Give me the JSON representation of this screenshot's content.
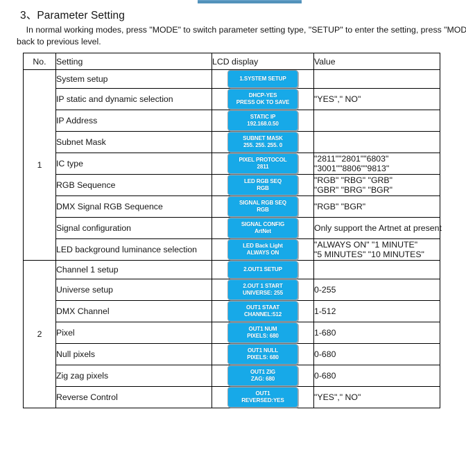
{
  "document": {
    "section_heading": "3、Parameter Setting",
    "intro_paragraph": "    In normal working modes, press \"MODE\" to switch parameter setting type, \"SETUP\" to enter the setting, press \"MODE\" to back to previous level."
  },
  "table": {
    "headers": {
      "no": "No.",
      "setting": "Setting",
      "lcd": "LCD display",
      "value": "Value"
    },
    "groups": [
      {
        "number": "1",
        "rows": [
          {
            "setting": "System setup",
            "lcd_line1": "1.SYSTEM SETUP",
            "lcd_line2": "",
            "value_line1": "",
            "value_line2": ""
          },
          {
            "setting": "IP static and dynamic selection",
            "lcd_line1": "DHCP-YES",
            "lcd_line2": "PRESS OK TO SAVE",
            "value_line1": "\"YES\",\" NO\"",
            "value_line2": ""
          },
          {
            "setting": "IP Address",
            "lcd_line1": "STATIC IP",
            "lcd_line2": "192.168.0.50",
            "value_line1": "",
            "value_line2": ""
          },
          {
            "setting": "Subnet Mask",
            "lcd_line1": "SUBNET MASK",
            "lcd_line2": "255. 255. 255. 0",
            "value_line1": "",
            "value_line2": ""
          },
          {
            "setting": "IC type",
            "lcd_line1": "PIXEL PROTOCOL",
            "lcd_line2": "2811",
            "value_line1": "\"2811\"\"2801\"\"6803\"",
            "value_line2": "\"3001\"\"8806\"\"9813\""
          },
          {
            "setting": "RGB Sequence",
            "lcd_line1": "LED RGB SEQ",
            "lcd_line2": "RGB",
            "value_line1": "\"RGB\" \"RBG\" \"GRB\"",
            "value_line2": "\"GBR\" \"BRG\" \"BGR\""
          },
          {
            "setting": "DMX Signal RGB Sequence",
            "lcd_line1": "SIGNAL RGB SEQ",
            "lcd_line2": "RGB",
            "value_line1": "\"RGB\" \"BGR\"",
            "value_line2": ""
          },
          {
            "setting": "Signal configuration",
            "lcd_line1": "SIGNAL CONFIG",
            "lcd_line2": "ArtNet",
            "value_line1": "Only support the Artnet at present",
            "value_line2": ""
          },
          {
            "setting": "LED background luminance selection",
            "lcd_line1": "LED Back Light",
            "lcd_line2": "ALWAYS ON",
            "value_line1": "\"ALWAYS ON\" \"1 MINUTE\"",
            "value_line2": "\"5 MINUTES\" \"10 MINUTES\""
          }
        ]
      },
      {
        "number": "2",
        "rows": [
          {
            "setting": "Channel 1 setup",
            "lcd_line1": "2.OUT1 SETUP",
            "lcd_line2": "",
            "value_line1": "",
            "value_line2": ""
          },
          {
            "setting": "Universe setup",
            "lcd_line1": "2.OUT 1 START",
            "lcd_line2": "UNIVERSE: 255",
            "value_line1": "0-255",
            "value_line2": ""
          },
          {
            "setting": "DMX Channel",
            "lcd_line1": "OUT1 STAAT",
            "lcd_line2": "CHANNEL:512",
            "value_line1": "1-512",
            "value_line2": ""
          },
          {
            "setting": "Pixel",
            "lcd_line1": "OUT1 NUM",
            "lcd_line2": "PIXELS: 680",
            "value_line1": "1-680",
            "value_line2": ""
          },
          {
            "setting": "Null pixels",
            "lcd_line1": "OUT1 NULL",
            "lcd_line2": "PIXELS: 680",
            "value_line1": "0-680",
            "value_line2": ""
          },
          {
            "setting": "Zig zag pixels",
            "lcd_line1": "OUT1  ZIG",
            "lcd_line2": "ZAG: 680",
            "value_line1": "0-680",
            "value_line2": ""
          },
          {
            "setting": "Reverse Control",
            "lcd_line1": "OUT1",
            "lcd_line2": "REVERSED:YES",
            "value_line1": "\"YES\",\" NO\"",
            "value_line2": ""
          }
        ]
      }
    ]
  },
  "colors": {
    "lcd_background": "#17a9e8",
    "lcd_text": "#ffffff",
    "top_bar": "#4a8cb5",
    "table_border": "#000000"
  }
}
